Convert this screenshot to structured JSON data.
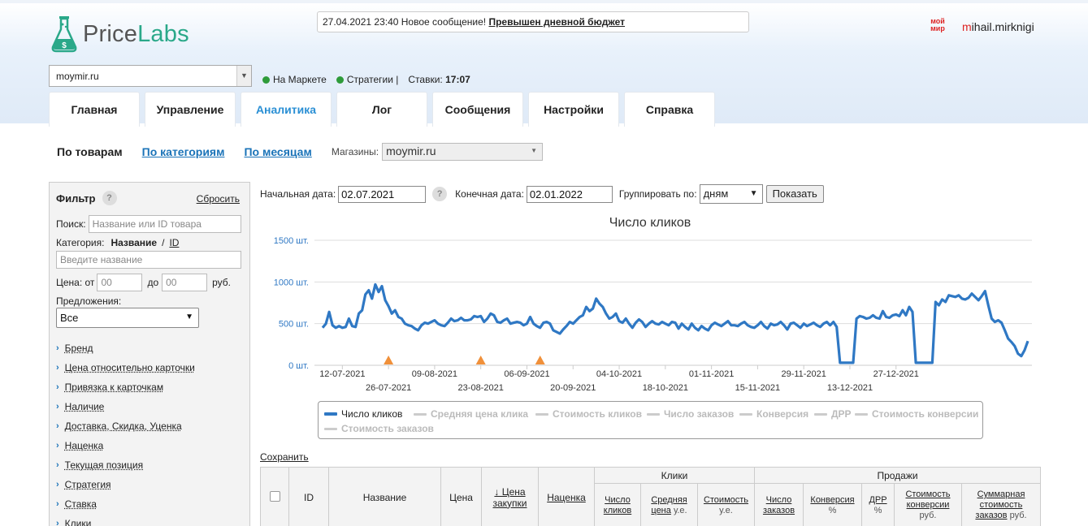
{
  "header": {
    "logo_text_1": "Price",
    "logo_text_2": "Labs",
    "notice_prefix": "27.04.2021 23:40 Новое сообщение!",
    "notice_link": "Превышен дневной бюджет",
    "user_logo": "мой мир",
    "user_first_letter": "m",
    "user_rest": "ihail.mirknigi",
    "store_value": "moymir.ru",
    "status_market": "На Маркете",
    "status_strategies": "Стратегии |",
    "status_bids_label": "Ставки:",
    "status_bids_time": "17:07"
  },
  "tabs": [
    {
      "label": "Главная"
    },
    {
      "label": "Управление"
    },
    {
      "label": "Аналитика"
    },
    {
      "label": "Лог"
    },
    {
      "label": "Сообщения"
    },
    {
      "label": "Настройки"
    },
    {
      "label": "Справка"
    }
  ],
  "subnav": {
    "current": "По товарам",
    "link_categories": "По категориям",
    "link_months": "По месяцам",
    "shops_label": "Магазины:",
    "shops_value": "moymir.ru"
  },
  "filter": {
    "title": "Фильтр",
    "help": "?",
    "reset": "Сбросить",
    "search_label": "Поиск:",
    "search_placeholder": "Название или ID товара",
    "category_label": "Категория:",
    "category_name": "Название",
    "category_sep": "/",
    "category_id": "ID",
    "category_placeholder": "Введите название",
    "price_label": "Цена: от",
    "price_from": "00",
    "price_to_label": "до",
    "price_to": "00",
    "price_currency": "руб.",
    "offers_label": "Предложения:",
    "offers_value": "Все",
    "items": [
      "Бренд",
      "Цена относительно карточки",
      "Привязка к карточкам",
      "Наличие",
      "Доставка, Скидка, Уценка",
      "Наценка",
      "Текущая позиция",
      "Стратегия",
      "Ставка",
      "Клики"
    ]
  },
  "controls": {
    "start_label": "Начальная дата:",
    "start_value": "02.07.2021",
    "help": "?",
    "end_label": "Конечная дата:",
    "end_value": "02.01.2022",
    "group_label": "Группировать по:",
    "group_value": "дням",
    "show_button": "Показать"
  },
  "chart_data": {
    "type": "line",
    "title": "Число кликов",
    "ylim": [
      0,
      1500
    ],
    "yticks": [
      "0 шт.",
      "500 шт.",
      "1000 шт.",
      "1500 шт."
    ],
    "ytick_values": [
      0,
      500,
      1000,
      1500
    ],
    "x_start": "2021-07-06",
    "xticks_upper": [
      "12-07-2021",
      "09-08-2021",
      "06-09-2021",
      "04-10-2021",
      "01-11-2021",
      "29-11-2021",
      "27-12-2021"
    ],
    "xticks_lower": [
      "26-07-2021",
      "23-08-2021",
      "20-09-2021",
      "18-10-2021",
      "15-11-2021",
      "13-12-2021"
    ],
    "markers": [
      "2021-07-26",
      "2021-08-23",
      "2021-09-10"
    ],
    "series": [
      {
        "name": "Число кликов",
        "color": "#2f78c4",
        "values": [
          450,
          500,
          640,
          480,
          450,
          470,
          450,
          460,
          560,
          470,
          460,
          620,
          660,
          850,
          900,
          800,
          970,
          880,
          950,
          780,
          710,
          620,
          660,
          580,
          560,
          500,
          480,
          470,
          440,
          420,
          480,
          510,
          500,
          520,
          540,
          500,
          480,
          470,
          510,
          560,
          530,
          540,
          570,
          540,
          540,
          550,
          590,
          580,
          590,
          520,
          560,
          620,
          600,
          520,
          510,
          540,
          560,
          500,
          510,
          520,
          510,
          480,
          500,
          580,
          500,
          470,
          450,
          510,
          520,
          500,
          420,
          400,
          380,
          430,
          470,
          520,
          500,
          540,
          580,
          600,
          700,
          650,
          680,
          800,
          740,
          700,
          620,
          560,
          580,
          620,
          530,
          510,
          560,
          500,
          450,
          510,
          550,
          520,
          460,
          500,
          530,
          500,
          490,
          520,
          500,
          480,
          520,
          510,
          440,
          500,
          460,
          430,
          500,
          450,
          420,
          470,
          440,
          420,
          480,
          510,
          490,
          470,
          500,
          530,
          480,
          480,
          470,
          500,
          520,
          480,
          460,
          450,
          480,
          520,
          470,
          440,
          500,
          480,
          490,
          520,
          480,
          430,
          500,
          510,
          480,
          450,
          500,
          470,
          490,
          510,
          480,
          460,
          500,
          520,
          480,
          520,
          460,
          30,
          30,
          30,
          30,
          30,
          560,
          590,
          580,
          560,
          570,
          600,
          570,
          560,
          650,
          580,
          570,
          600,
          610,
          590,
          660,
          600,
          700,
          640,
          30,
          30,
          30,
          30,
          30,
          30,
          760,
          720,
          790,
          760,
          840,
          830,
          820,
          840,
          800,
          790,
          810,
          860,
          820,
          780,
          830,
          890,
          720,
          560,
          520,
          540,
          510,
          420,
          320,
          280,
          230,
          140,
          110,
          180,
          290
        ]
      }
    ],
    "legend": [
      {
        "label": "Число кликов",
        "active": true
      },
      {
        "label": "Средняя цена клика",
        "active": false
      },
      {
        "label": "Стоимость кликов",
        "active": false
      },
      {
        "label": "Число заказов",
        "active": false
      },
      {
        "label": "Конверсия",
        "active": false
      },
      {
        "label": "ДРР",
        "active": false
      },
      {
        "label": "Стоимость конверсии",
        "active": false
      },
      {
        "label": "Стоимость заказов",
        "active": false
      }
    ]
  },
  "save_link": "Сохранить",
  "table": {
    "col_id": "ID",
    "col_name": "Название",
    "col_price": "Цена",
    "col_purchase_1": "↓ Цена",
    "col_purchase_2": "закупки",
    "col_margin": "Наценка",
    "group_clicks": "Клики",
    "group_sales": "Продажи",
    "clicks_count_1": "Число",
    "clicks_count_2": "кликов",
    "avg_price_1": "Средняя",
    "avg_price_2": "цена",
    "avg_price_unit": "у.е.",
    "cost_1": "Стоимость",
    "cost_unit": "у.е.",
    "orders_1": "Число",
    "orders_2": "заказов",
    "conv_1": "Конверсия",
    "conv_unit": "%",
    "drr_1": "ДРР",
    "drr_unit": "%",
    "conv_cost_1": "Стоимость",
    "conv_cost_2": "конверсии",
    "conv_cost_unit": "руб.",
    "sum_cost_1": "Суммарная",
    "sum_cost_2": "стоимость",
    "sum_cost_3": "заказов",
    "sum_cost_unit": "руб."
  }
}
